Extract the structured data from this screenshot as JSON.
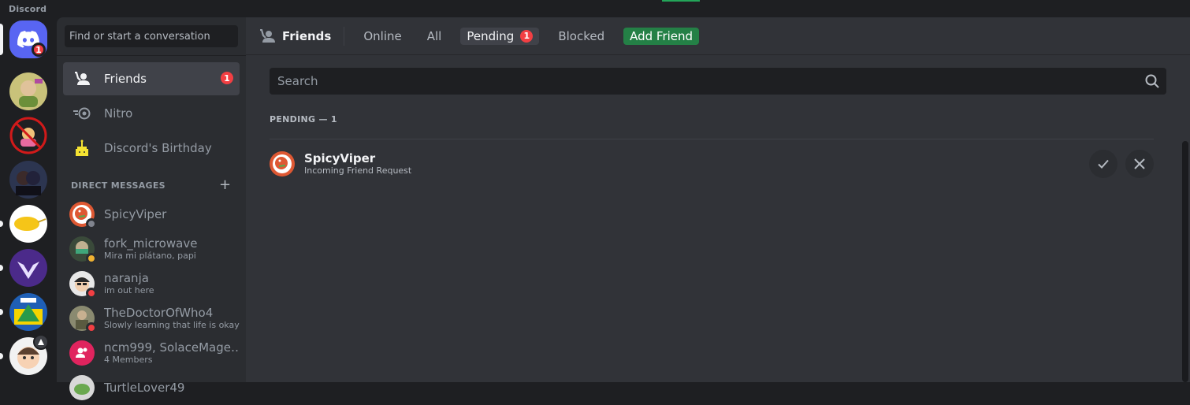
{
  "app": {
    "title": "Discord"
  },
  "servers": {
    "home_badge": "1",
    "items": [
      {
        "name": "server-1",
        "color": "#c9c27a"
      },
      {
        "name": "server-2",
        "color": "#b72020"
      },
      {
        "name": "server-3",
        "color": "#2c3550"
      },
      {
        "name": "server-4",
        "color": "#ffffff"
      },
      {
        "name": "server-5",
        "color": "#4b2a8a"
      },
      {
        "name": "server-6",
        "color": "#1f5fb5"
      },
      {
        "name": "server-7",
        "color": "#f2f2f2"
      }
    ]
  },
  "sidebar": {
    "search_placeholder": "Find or start a conversation",
    "nav": [
      {
        "label": "Friends",
        "badge": "1"
      },
      {
        "label": "Nitro"
      },
      {
        "label": "Discord's Birthday"
      }
    ],
    "dm_header": "DIRECT MESSAGES",
    "dm_add": "+",
    "dms": [
      {
        "name": "SpicyViper",
        "sub": "",
        "status": "offline"
      },
      {
        "name": "fork_microwave",
        "sub": "Mira mi plátano, papi",
        "status": "idle"
      },
      {
        "name": "naranja",
        "sub": "im out here",
        "status": "dnd"
      },
      {
        "name": "TheDoctorOfWho4",
        "sub": "Slowly learning that life is okay",
        "status": "dnd"
      },
      {
        "name": "ncm999, SolaceMage, ...",
        "sub": "4 Members",
        "status": ""
      },
      {
        "name": "TurtleLover49",
        "sub": "",
        "status": ""
      }
    ]
  },
  "topbar": {
    "title": "Friends",
    "tabs": [
      "Online",
      "All",
      "Pending",
      "Blocked"
    ],
    "pending_badge": "1",
    "add_friend": "Add Friend"
  },
  "main": {
    "search_placeholder": "Search",
    "section_label": "PENDING — 1",
    "requests": [
      {
        "name": "SpicyViper",
        "sub": "Incoming Friend Request"
      }
    ]
  },
  "colors": {
    "blurple": "#5865f2",
    "danger": "#f23f43",
    "green": "#248046",
    "idle": "#f0b232",
    "offline": "#80848e"
  }
}
